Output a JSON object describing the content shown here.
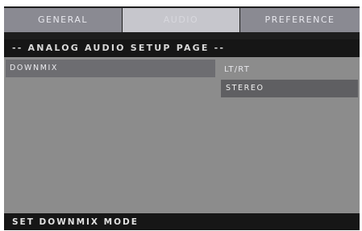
{
  "tabs": [
    {
      "label": "GENERAL",
      "active": false
    },
    {
      "label": "AUDIO",
      "active": true
    },
    {
      "label": "PREFERENCE",
      "active": false
    }
  ],
  "header": {
    "title": "-- ANALOG AUDIO SETUP PAGE --"
  },
  "settings": {
    "item": {
      "label": "DOWNMIX"
    },
    "current_value": "LT/RT",
    "options": [
      {
        "label": "STEREO",
        "highlighted": true
      }
    ]
  },
  "footer": {
    "hint": "SET DOWNMIX MODE"
  },
  "colors": {
    "header_bg": "#161616",
    "panel_bg": "#8c8c8c",
    "highlight_bg": "#5f5f62",
    "active_tab_bg": "#c6c6cc"
  }
}
